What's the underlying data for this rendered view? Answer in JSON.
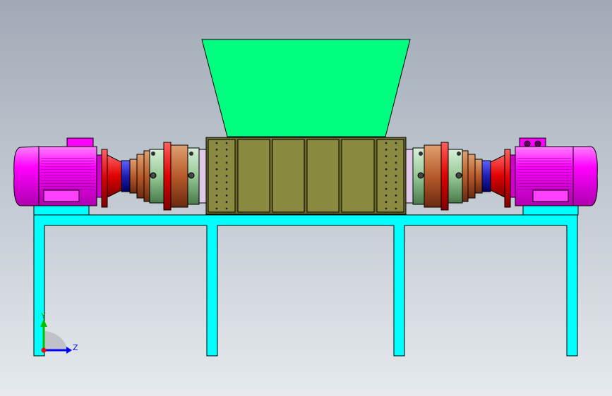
{
  "viewport": {
    "background_top": "#a0aab6",
    "background_bottom": "#e6eaee"
  },
  "colors": {
    "hopper": "#00ff80",
    "frame": "#00ffff",
    "shredder_box": "#6b6b2e",
    "motor": "#ff00ff",
    "flange": "#ff0000",
    "gearbox": "#c86432",
    "coupling": "#1e1eb4",
    "bearing_green": "#96c896",
    "outline": "#000000"
  },
  "triad": {
    "y_label": "Y",
    "z_label": "Z",
    "y_color": "#00c000",
    "z_color": "#0000ff"
  },
  "components": [
    "hopper-icon",
    "shredder-box-icon",
    "left-motor-icon",
    "right-motor-icon",
    "left-gearbox-icon",
    "right-gearbox-icon",
    "frame-icon"
  ]
}
